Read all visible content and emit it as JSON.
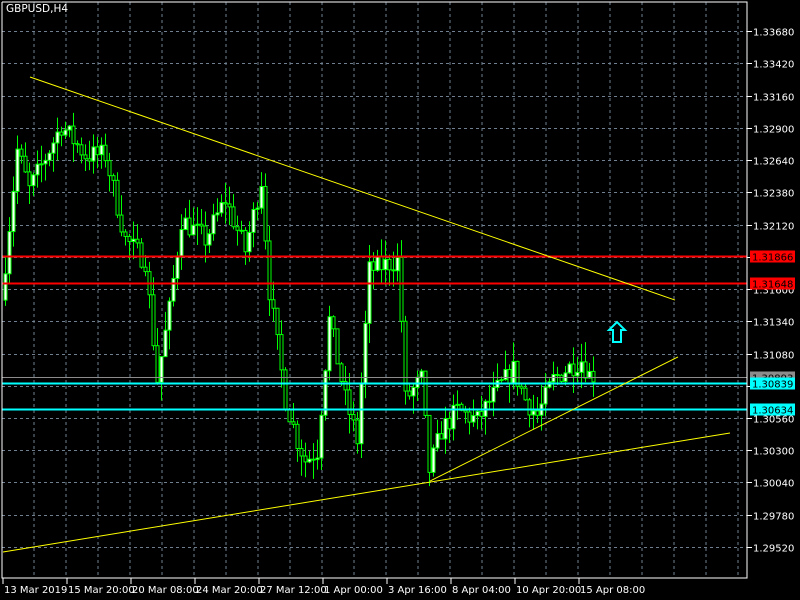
{
  "window": {
    "title": "GBPUSD,H4"
  },
  "colors": {
    "background": "#000000",
    "grid": "#6f7f8f",
    "axis": "#ffffff",
    "candle_wick": "#00ff00",
    "bull_body": "#ffffff",
    "bear_body": "#000000",
    "trendline": "#ffff00",
    "resistance": "#ff0000",
    "support": "#00ffff",
    "bid_line": "#8c8c8c",
    "arrow": "#00ffff"
  },
  "chart_data": {
    "type": "candlestick",
    "title": "GBPUSD,H4",
    "symbol": "GBPUSD",
    "timeframe": "H4",
    "ylim": [
      1.2926,
      1.338
    ],
    "y_ticks": [
      "1.33680",
      "1.33420",
      "1.33160",
      "1.32900",
      "1.32640",
      "1.32380",
      "1.32120",
      "1.31860",
      "1.31600",
      "1.31340",
      "1.31080",
      "1.30820",
      "1.30560",
      "1.30300",
      "1.30040",
      "1.29780",
      "1.29520"
    ],
    "y_tick_labels_shown": [
      "1.33680",
      "1.33420",
      "1.33160",
      "1.32900",
      "1.32640",
      "1.32380",
      "1.32120",
      "1.31600",
      "1.31340",
      "1.31080",
      "1.30560",
      "1.30300",
      "1.30040",
      "1.29780",
      "1.29520"
    ],
    "x_tick_labels": [
      {
        "bar": 0,
        "label": "13 Mar 2019"
      },
      {
        "bar": 16,
        "label": "15 Mar 20:00"
      },
      {
        "bar": 32,
        "label": "20 Mar 08:00"
      },
      {
        "bar": 48,
        "label": "24 Mar 20:00"
      },
      {
        "bar": 64,
        "label": "27 Mar 12:00"
      },
      {
        "bar": 80,
        "label": "1 Apr 00:00"
      },
      {
        "bar": 96,
        "label": "3 Apr 16:00"
      },
      {
        "bar": 112,
        "label": "8 Apr 04:00"
      },
      {
        "bar": 128,
        "label": "10 Apr 20:00"
      },
      {
        "bar": 144,
        "label": "15 Apr 08:00"
      }
    ],
    "bar_count": 148,
    "approx_close_path": [
      [
        0,
        1.3151
      ],
      [
        4,
        1.3272
      ],
      [
        7,
        1.324
      ],
      [
        15,
        1.3292
      ],
      [
        21,
        1.3268
      ],
      [
        26,
        1.3268
      ],
      [
        31,
        1.32
      ],
      [
        36,
        1.3183
      ],
      [
        39,
        1.3087
      ],
      [
        42,
        1.3143
      ],
      [
        45,
        1.3216
      ],
      [
        51,
        1.32
      ],
      [
        56,
        1.3232
      ],
      [
        61,
        1.3191
      ],
      [
        65,
        1.3248
      ],
      [
        67,
        1.3159
      ],
      [
        71,
        1.3071
      ],
      [
        74,
        1.3038
      ],
      [
        76,
        1.3022
      ],
      [
        79,
        1.303
      ],
      [
        82,
        1.3135
      ],
      [
        86,
        1.3071
      ],
      [
        89,
        1.3038
      ],
      [
        92,
        1.3175
      ],
      [
        99,
        1.3183
      ],
      [
        100,
        1.3135
      ],
      [
        101,
        1.3071
      ],
      [
        105,
        1.3087
      ],
      [
        107,
        1.3014
      ],
      [
        110,
        1.3046
      ],
      [
        114,
        1.3062
      ],
      [
        119,
        1.3054
      ],
      [
        124,
        1.3079
      ],
      [
        128,
        1.3095
      ],
      [
        131,
        1.3071
      ],
      [
        134,
        1.3058
      ],
      [
        138,
        1.3087
      ],
      [
        141,
        1.3095
      ],
      [
        145,
        1.3103
      ],
      [
        147,
        1.3091
      ]
    ],
    "horizontal_lines": [
      {
        "price": 1.31866,
        "label": "1.31866",
        "kind": "resistance"
      },
      {
        "price": 1.31648,
        "label": "1.31648",
        "kind": "resistance"
      },
      {
        "price": 1.30893,
        "label": "1.30893",
        "kind": "bid"
      },
      {
        "price": 1.30839,
        "label": "1.30839",
        "kind": "support"
      },
      {
        "price": 1.30634,
        "label": "1.30634",
        "kind": "support"
      }
    ],
    "trendlines": [
      {
        "from": [
          6.25,
          1.33309
        ],
        "to": [
          167.5,
          1.31511
        ]
      },
      {
        "from": [
          106.25,
          1.30052
        ],
        "to": [
          168.25,
          1.31052
        ]
      },
      {
        "from": [
          -0.5,
          1.2948
        ],
        "to": [
          181.25,
          1.30439
        ]
      }
    ],
    "arrow": {
      "bar": 153,
      "price": 1.31253,
      "direction": "up",
      "icon": "up-arrow-icon"
    },
    "grid": true
  }
}
